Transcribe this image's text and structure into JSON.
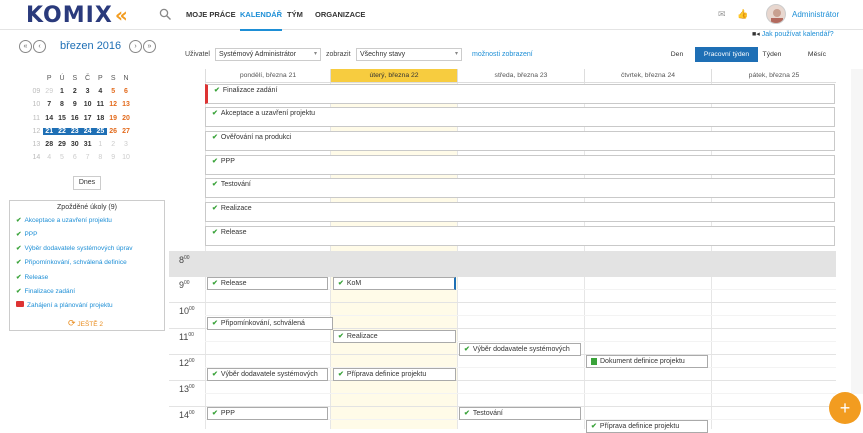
{
  "app": {
    "logo": "KOMIX",
    "logo_chevrons": "«"
  },
  "nav": [
    {
      "label": "MOJE PRÁCE"
    },
    {
      "label": "KALENDÁŘ"
    },
    {
      "label": "TÝM"
    },
    {
      "label": "ORGANIZACE"
    }
  ],
  "user": {
    "name": "Administrátor"
  },
  "mini_calendar": {
    "title": "březen 2016",
    "weekday_headers": [
      "P",
      "Ú",
      "S",
      "Č",
      "P",
      "S",
      "N"
    ],
    "weeks": [
      {
        "wk": "09",
        "days": [
          "29",
          "1",
          "2",
          "3",
          "4",
          "5",
          "6"
        ]
      },
      {
        "wk": "10",
        "days": [
          "7",
          "8",
          "9",
          "10",
          "11",
          "12",
          "13"
        ]
      },
      {
        "wk": "11",
        "days": [
          "14",
          "15",
          "16",
          "17",
          "18",
          "19",
          "20"
        ]
      },
      {
        "wk": "12",
        "days": [
          "21",
          "22",
          "23",
          "24",
          "25",
          "26",
          "27"
        ]
      },
      {
        "wk": "13",
        "days": [
          "28",
          "29",
          "30",
          "31",
          "1",
          "2",
          "3"
        ]
      },
      {
        "wk": "14",
        "days": [
          "4",
          "5",
          "6",
          "7",
          "8",
          "9",
          "10"
        ]
      }
    ],
    "today_label": "Dnes"
  },
  "late_tasks": {
    "title": "Zpožděné úkoly (9)",
    "items": [
      "Akceptace a uzavření projektu",
      "PPP",
      "Výběr dodavatele systémových úprav",
      "Připomínkování, schválená definice",
      "Release",
      "Finalizace zadání",
      "Zahájení a plánování projektu"
    ],
    "more": "JEŠTĚ 2"
  },
  "filters": {
    "user_label": "Uživatel",
    "user_value": "Systémový Administrátor",
    "show_label": "zobrazit",
    "show_value": "Všechny stavy",
    "options_link": "možnosti zobrazení",
    "howto": "Jak používat kalendář?"
  },
  "views": [
    "Den",
    "Pracovní týden",
    "Týden",
    "Měsíc"
  ],
  "days": [
    "pondělí, března 21",
    "úterý, března 22",
    "středa, března 23",
    "čtvrtek, března 24",
    "pátek, března 25"
  ],
  "allday_events": [
    "Finalizace zadání",
    "Akceptace a uzavření projektu",
    "Ověřování na produkci",
    "PPP",
    "Testování",
    "Realizace",
    "Release"
  ],
  "hours": [
    "8",
    "9",
    "10",
    "11",
    "12",
    "13",
    "14"
  ],
  "minutes": "00",
  "timed_events": [
    {
      "label": "Release",
      "day": 0,
      "hour": 9
    },
    {
      "label": "KoM",
      "day": 1,
      "hour": 9
    },
    {
      "label": "Připomínkování, schválená",
      "day": 0,
      "hour": 10
    },
    {
      "label": "Realizace",
      "day": 1,
      "hour": 11
    },
    {
      "label": "Výběr dodavatele systémových",
      "day": 2,
      "hour": 11
    },
    {
      "label": "Dokument definice projektu",
      "day": 3,
      "hour": 12
    },
    {
      "label": "Výběr dodavatele systémových",
      "day": 0,
      "hour": 12
    },
    {
      "label": "Příprava definice projektu",
      "day": 1,
      "hour": 12
    },
    {
      "label": "PPP",
      "day": 0,
      "hour": 14
    },
    {
      "label": "Testování",
      "day": 2,
      "hour": 14
    },
    {
      "label": "Příprava definice projektu",
      "day": 3,
      "hour": 14
    }
  ],
  "fab": "+"
}
